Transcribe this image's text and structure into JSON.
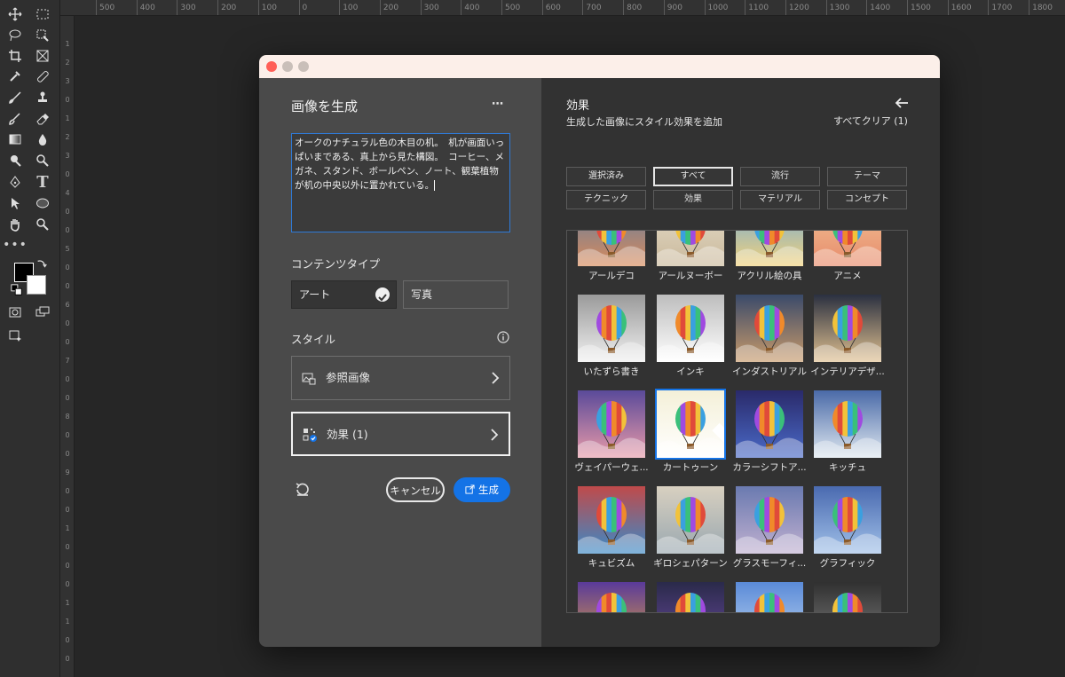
{
  "ruler": {
    "top_labels": [
      "500",
      "400",
      "300",
      "200",
      "100",
      "0",
      "100",
      "200",
      "300",
      "400",
      "500",
      "600",
      "700",
      "800",
      "900",
      "1000",
      "1100",
      "1200",
      "1300",
      "1400",
      "1500",
      "1600",
      "1700",
      "1800"
    ],
    "left_labels": [
      "1",
      "2",
      "3",
      "0",
      "1",
      "2",
      "3",
      "0",
      "4",
      "0",
      "0",
      "5",
      "0",
      "0",
      "6",
      "0",
      "0",
      "7",
      "0",
      "0",
      "8",
      "0",
      "0",
      "9",
      "0",
      "0",
      "1",
      "0",
      "0",
      "0",
      "1",
      "1",
      "0",
      "0"
    ]
  },
  "dialog": {
    "title": "画像を生成",
    "more_label": "⋯",
    "prompt": "オークのナチュラル色の木目の机。　机が画面いっぱいまである、真上から見た構図。　コーヒー、メガネ、スタンド、ボールペン、ノート、観葉植物が机の中央以外に置かれている。",
    "content_type": {
      "label": "コンテンツタイプ",
      "options": [
        "アート",
        "写真"
      ],
      "selected": "アート"
    },
    "style": {
      "label": "スタイル",
      "reference_label": "参照画像",
      "effects_label": "効果 (1)"
    },
    "cancel_label": "キャンセル",
    "generate_label": "生成",
    "accent": "#1473e6"
  },
  "effects": {
    "title": "効果",
    "subtitle": "生成した画像にスタイル効果を追加",
    "clear_all": "すべてクリア (1)",
    "filters": [
      "選択済み",
      "すべて",
      "流行",
      "テーマ",
      "テクニック",
      "効果",
      "マテリアル",
      "コンセプト"
    ],
    "active_filter": "すべて",
    "rows": [
      [
        "アールデコ",
        "アールヌーボー",
        "アクリル絵の具",
        "アニメ"
      ],
      [
        "いたずら書き",
        "インキ",
        "インダストリアル",
        "インテリアデザ..."
      ],
      [
        "ヴェイパーウェ...",
        "カートゥーン",
        "カラーシフトア...",
        "キッチュ"
      ],
      [
        "キュビズム",
        "ギロシェパターン",
        "グラスモーフィ...",
        "グラフィック"
      ]
    ],
    "selected_effect": "カートゥーン"
  }
}
